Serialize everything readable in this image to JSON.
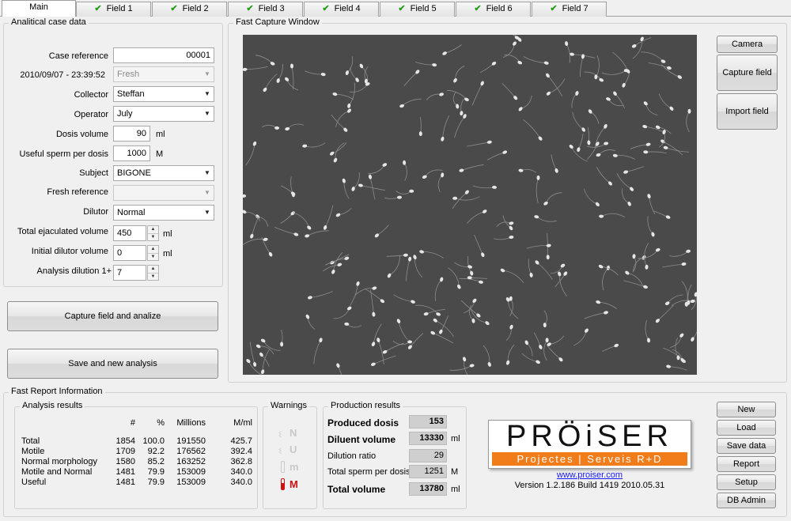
{
  "tabs": [
    {
      "label": "Main",
      "checked": false
    },
    {
      "label": "Field 1",
      "checked": true
    },
    {
      "label": "Field 2",
      "checked": true
    },
    {
      "label": "Field 3",
      "checked": true
    },
    {
      "label": "Field 4",
      "checked": true
    },
    {
      "label": "Field 5",
      "checked": true
    },
    {
      "label": "Field 6",
      "checked": true
    },
    {
      "label": "Field 7",
      "checked": true
    }
  ],
  "case": {
    "group_title": "Analitical case data",
    "case_ref_label": "Case reference",
    "case_ref_value": "00001",
    "datetime": "2010/09/07 - 23:39:52",
    "fresh_value": "Fresh",
    "collector_label": "Collector",
    "collector_value": "Steffan",
    "operator_label": "Operator",
    "operator_value": "July",
    "dosis_volume_label": "Dosis volume",
    "dosis_volume_value": "90",
    "dosis_volume_unit": "ml",
    "useful_sperm_label": "Useful sperm per dosis",
    "useful_sperm_value": "1000",
    "useful_sperm_unit": "M",
    "subject_label": "Subject",
    "subject_value": "BIGONE",
    "fresh_ref_label": "Fresh reference",
    "fresh_ref_value": "",
    "dilutor_label": "Dilutor",
    "dilutor_value": "Normal",
    "total_ejac_label": "Total ejaculated volume",
    "total_ejac_value": "450",
    "total_ejac_unit": "ml",
    "init_dilutor_label": "Initial dilutor volume",
    "init_dilutor_value": "0",
    "init_dilutor_unit": "ml",
    "analysis_dil_label": "Analysis dilution  1+",
    "analysis_dil_value": "7"
  },
  "actions": {
    "capture_analize": "Capture field and analize",
    "save_new": "Save and new analysis"
  },
  "capture": {
    "group_title": "Fast Capture Window",
    "camera": "Camera",
    "capture_field": "Capture field",
    "import_field": "Import field"
  },
  "report": {
    "group_title": "Fast Report Information",
    "analysis_title": "Analysis results",
    "headers": [
      "",
      "#",
      "%",
      "Millions",
      "M/ml"
    ],
    "rows": [
      {
        "label": "Total",
        "count": "1854",
        "pct": "100.0",
        "millions": "191550",
        "mml": "425.7",
        "bold": false
      },
      {
        "label": "Motile",
        "count": "1709",
        "pct": "92.2",
        "millions": "176562",
        "mml": "392.4",
        "bold": false
      },
      {
        "label": "Normal morphology",
        "count": "1580",
        "pct": "85.2",
        "millions": "163252",
        "mml": "362.8",
        "bold": false
      },
      {
        "label": "Motile and Normal",
        "count": "1481",
        "pct": "79.9",
        "millions": "153009",
        "mml": "340.0",
        "bold": false
      },
      {
        "label": "Useful",
        "count": "1481",
        "pct": "79.9",
        "millions": "153009",
        "mml": "340.0",
        "bold": true
      }
    ],
    "warnings_title": "Warnings",
    "warnings": [
      "N",
      "U",
      "m",
      "M"
    ],
    "production_title": "Production results",
    "produced_label": "Produced dosis",
    "produced_value": "153",
    "diluent_label": "Diluent volume",
    "diluent_value": "13330",
    "diluent_unit": "ml",
    "ratio_label": "Dilution ratio",
    "ratio_value": "29",
    "total_sperm_label": "Total sperm per dosis",
    "total_sperm_value": "1251",
    "total_sperm_unit": "M",
    "total_volume_label": "Total volume",
    "total_volume_value": "13780",
    "total_volume_unit": "ml"
  },
  "brand": {
    "logo_text": "PRÖiSER",
    "logo_sub": "Projectes | Serveis R+D",
    "url": "www.proiser.com",
    "version": "Version 1.2.186 Build 1419 2010.05.31"
  },
  "side_buttons": [
    "New",
    "Load",
    "Save data",
    "Report",
    "Setup",
    "DB Admin"
  ],
  "colors": {
    "logo_orange": "#f07c1a",
    "warning_red": "#d01010",
    "check_green": "#2a9d1e"
  }
}
